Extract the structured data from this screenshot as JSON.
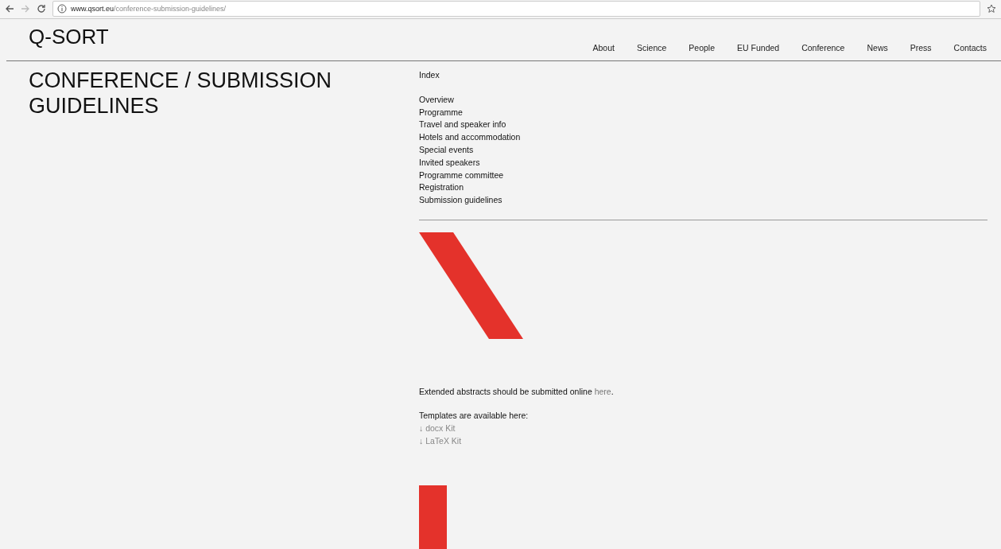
{
  "browser": {
    "url_host": "www.qsort.eu",
    "url_path": "/conference-submission-guidelines/"
  },
  "header": {
    "logo": "Q-SORT",
    "nav": [
      "About",
      "Science",
      "People",
      "EU Funded",
      "Conference",
      "News",
      "Press",
      "Contacts"
    ]
  },
  "page_title": "CONFERENCE / SUBMISSION GUIDELINES",
  "index": {
    "heading": "Index",
    "items": [
      "Overview",
      "Programme",
      "Travel and speaker info",
      "Hotels and accommodation",
      "Special events",
      "Invited speakers",
      "Programme committee",
      "Registration",
      "Submission guidelines"
    ]
  },
  "submission": {
    "text_before": "Extended abstracts should be submitted online ",
    "link": "here",
    "text_after": "."
  },
  "templates": {
    "heading": "Templates are available here:",
    "links": [
      "↓ docx Kit",
      "↓ LaTeX Kit"
    ]
  }
}
